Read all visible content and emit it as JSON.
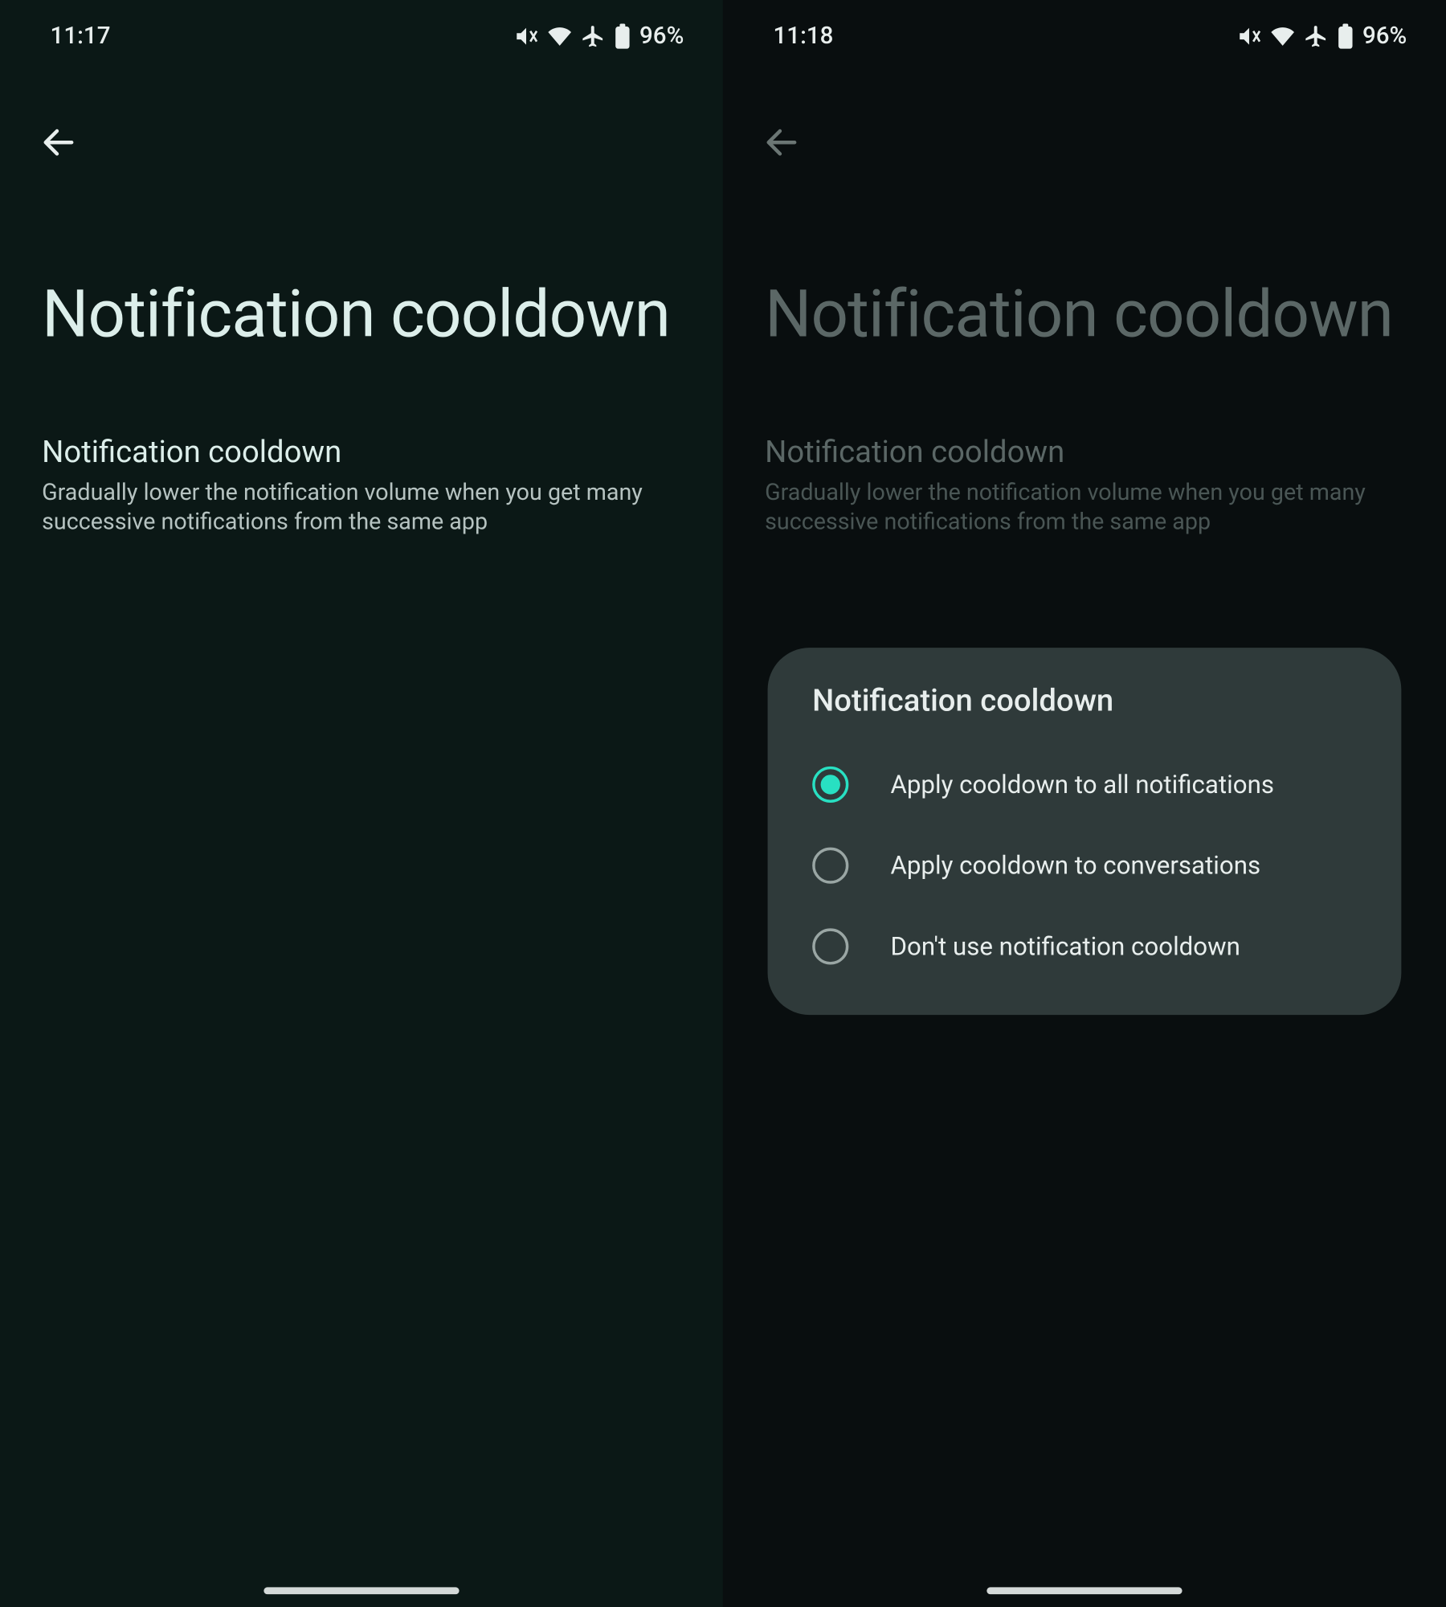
{
  "left": {
    "status": {
      "time": "11:17",
      "battery": "96%"
    },
    "title": "Notification cooldown",
    "section": {
      "heading": "Notification cooldown",
      "description": "Gradually lower the notification volume when you get many successive notifications from the same app"
    }
  },
  "right": {
    "status": {
      "time": "11:18",
      "battery": "96%"
    },
    "title": "Notification cooldown",
    "section": {
      "heading": "Notification cooldown",
      "description": "Gradually lower the notification volume when you get many successive notifications from the same app"
    },
    "dialog": {
      "title": "Notification cooldown",
      "options": [
        {
          "label": "Apply cooldown to all notifications",
          "selected": true
        },
        {
          "label": "Apply cooldown to conversations",
          "selected": false
        },
        {
          "label": "Don't use notification cooldown",
          "selected": false
        }
      ]
    }
  },
  "icons": {
    "mute": "mute-icon",
    "wifi": "wifi-icon",
    "airplane": "airplane-icon",
    "battery": "battery-icon",
    "back": "back-arrow-icon"
  }
}
